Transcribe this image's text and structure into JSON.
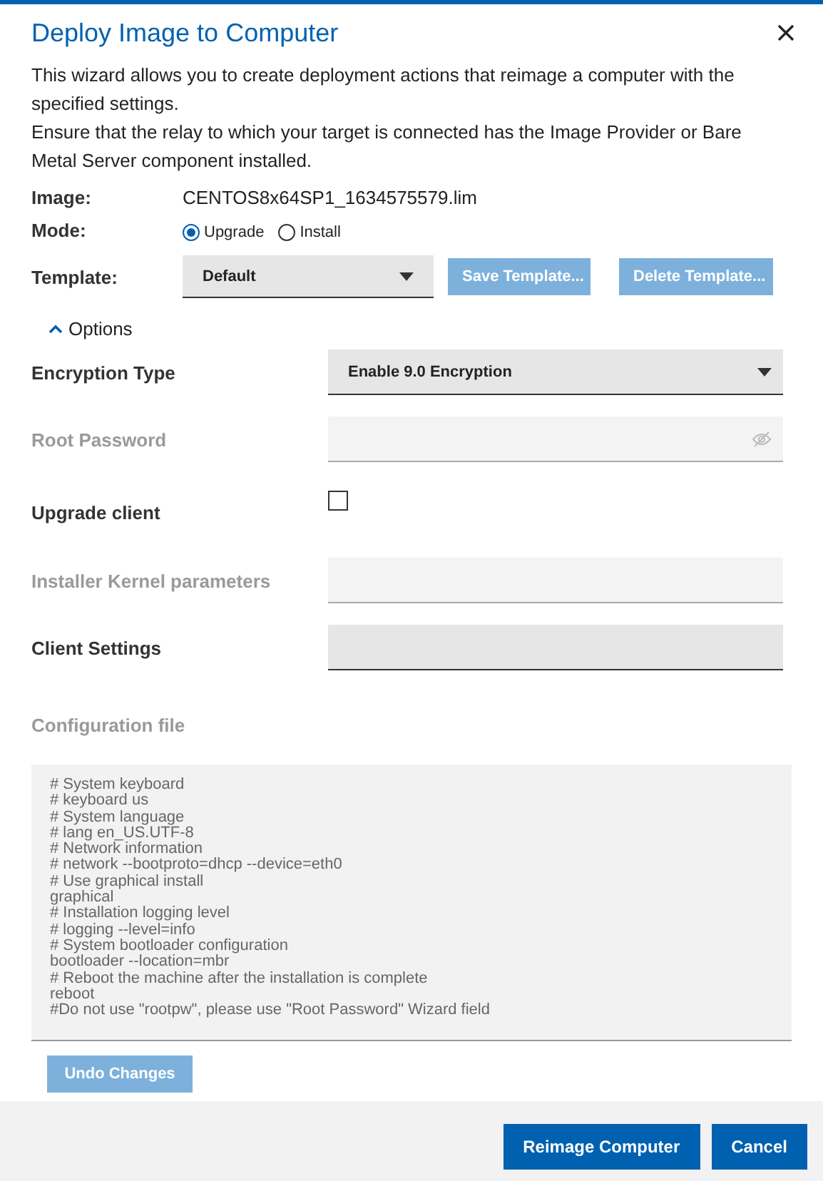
{
  "dialog": {
    "title": "Deploy Image to Computer",
    "description": [
      "This wizard allows you to create deployment actions that reimage a computer with the specified settings.",
      "Ensure that the relay to which your target is connected has the Image Provider or Bare Metal Server component installed."
    ],
    "image": {
      "label": "Image:",
      "value": "CENTOS8x64SP1_1634575579.lim"
    },
    "mode": {
      "label": "Mode:",
      "options": [
        {
          "label": "Upgrade",
          "selected": true
        },
        {
          "label": "Install",
          "selected": false
        }
      ]
    },
    "template": {
      "label": "Template:",
      "value": "Default",
      "buttons": [
        {
          "label": "Save Template...",
          "disabled": true
        },
        {
          "label": "Delete Template...",
          "disabled": true
        }
      ]
    },
    "options_toggle": {
      "label": "Options",
      "expanded": true
    },
    "fields": [
      {
        "kind": "select",
        "label": "Encryption Type",
        "disabled": false,
        "value": "Enable 9.0 Encryption"
      },
      {
        "kind": "password",
        "label": "Root Password",
        "disabled": true
      },
      {
        "kind": "checkbox",
        "label": "Upgrade client",
        "disabled": false,
        "checked": false
      },
      {
        "kind": "text",
        "label": "Installer Kernel parameters",
        "disabled": true
      },
      {
        "kind": "text",
        "label": "Client Settings",
        "disabled": false
      }
    ],
    "config": {
      "label": "Configuration file",
      "disabled": true,
      "lines": [
        "# System keyboard",
        "# keyboard us",
        "# System language",
        "# lang en_US.UTF-8",
        "# Network information",
        "# network --bootproto=dhcp --device=eth0",
        "# Use graphical install",
        "graphical",
        "# Installation logging level",
        "# logging --level=info",
        "# System bootloader configuration",
        "bootloader --location=mbr",
        "# Reboot the machine after the installation is complete",
        "reboot",
        "#Do not use \"rootpw\", please use \"Root Password\" Wizard field"
      ]
    },
    "undo_button": {
      "label": "Undo Changes",
      "disabled": true
    },
    "footer_buttons": [
      {
        "label": "Reimage Computer",
        "disabled": false
      },
      {
        "label": "Cancel",
        "disabled": false
      }
    ]
  }
}
